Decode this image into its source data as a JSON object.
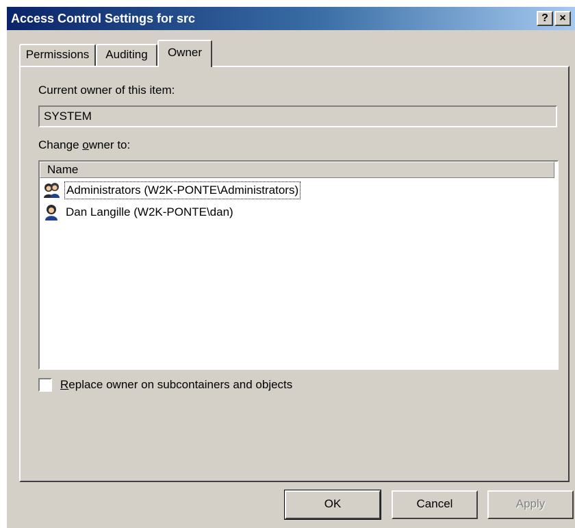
{
  "window": {
    "title": "Access Control Settings for src",
    "help_glyph": "?",
    "close_glyph": "×"
  },
  "tabs": [
    {
      "label": "Permissions",
      "active": false
    },
    {
      "label": "Auditing",
      "active": false
    },
    {
      "label": "Owner",
      "active": true
    }
  ],
  "owner": {
    "current_label": "Current owner of this item:",
    "current_value": "SYSTEM",
    "change_label_pre": "Change ",
    "change_label_key": "o",
    "change_label_post": "wner to:"
  },
  "list": {
    "column_header": "Name",
    "items": [
      {
        "label": "Administrators (W2K-PONTE\\Administrators)",
        "icon": "user-group-icon",
        "selected": true
      },
      {
        "label": "Dan Langille (W2K-PONTE\\dan)",
        "icon": "user-icon",
        "selected": false
      }
    ]
  },
  "replace_checkbox": {
    "key": "R",
    "label_rest": "eplace owner on subcontainers and objects",
    "checked": false
  },
  "buttons": {
    "ok": "OK",
    "cancel": "Cancel",
    "apply": "Apply"
  },
  "colors": {
    "title_start": "#0a246a",
    "title_end": "#a6caf0",
    "face": "#d4d0c8"
  }
}
